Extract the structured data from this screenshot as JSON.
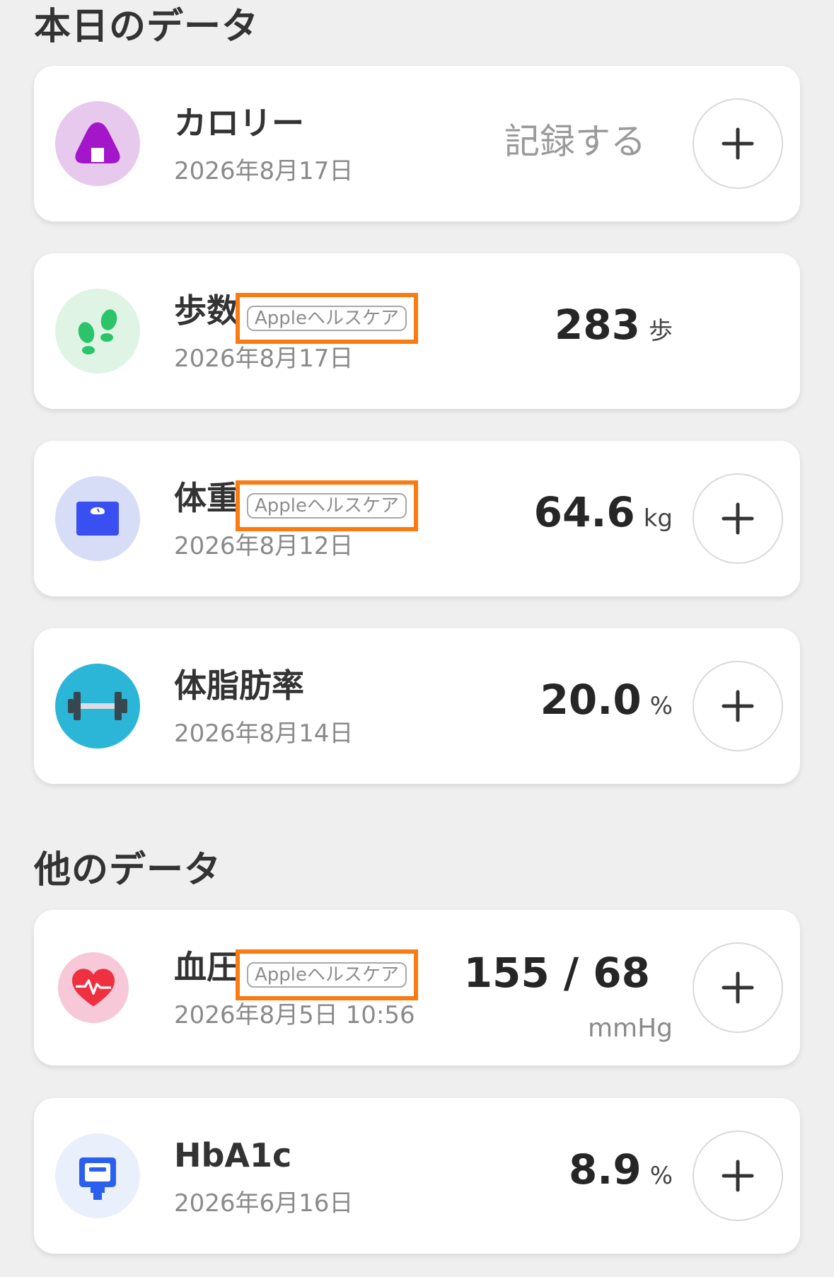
{
  "sections": {
    "today_title": "本日のデータ",
    "other_title": "他のデータ"
  },
  "colors": {
    "background": "#efefef",
    "card": "#ffffff",
    "highlight_border": "#f97b12",
    "calorie_icon_bg": "#e7c9ee",
    "calorie_icon": "#a316c9",
    "steps_icon_bg": "#e0f4e6",
    "steps_icon": "#2bc469",
    "weight_icon_bg": "#d7dcf7",
    "weight_icon": "#3a4ff2",
    "bodyfat_icon_bg": "#2bb5d6",
    "bp_icon_bg": "#f7c8d8",
    "bp_icon": "#ef3040",
    "hba1c_icon_bg": "#e9effb",
    "hba1c_icon": "#2a5ff0"
  },
  "cards": {
    "calorie": {
      "icon": "onigiri-icon",
      "name": "カロリー",
      "date": "2026年8月17日",
      "action": "記録する"
    },
    "steps": {
      "icon": "footprints-icon",
      "name": "歩数",
      "tag": "Appleヘルスケア",
      "date": "2026年8月17日",
      "value": "283",
      "unit": "歩"
    },
    "weight": {
      "icon": "scale-icon",
      "name": "体重",
      "tag": "Appleヘルスケア",
      "date": "2026年8月12日",
      "value": "64.6",
      "unit": "kg"
    },
    "bodyfat": {
      "icon": "dumbbell-icon",
      "name": "体脂肪率",
      "date": "2026年8月14日",
      "value": "20.0",
      "unit": "%"
    },
    "blood_pressure": {
      "icon": "heart-pulse-icon",
      "name": "血圧",
      "tag": "Appleヘルスケア",
      "date": "2026年8月5日 10:56",
      "value": "155 / 68",
      "unit": "mmHg"
    },
    "hba1c": {
      "icon": "glucose-meter-icon",
      "name": "HbA1c",
      "date": "2026年6月16日",
      "value": "8.9",
      "unit": "%"
    }
  }
}
